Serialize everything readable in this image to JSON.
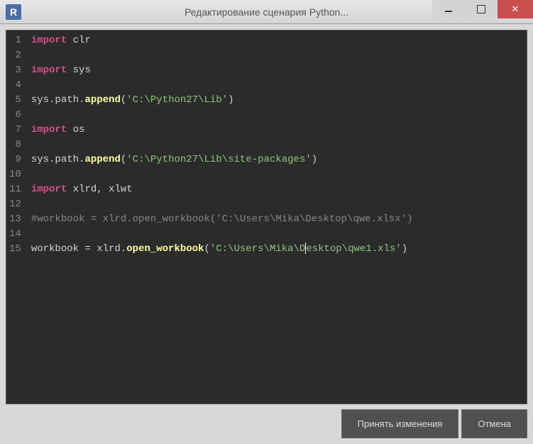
{
  "window": {
    "app_icon_letter": "R",
    "title": "Редактирование сценария Python..."
  },
  "editor": {
    "lines": [
      {
        "num": "1",
        "tokens": [
          {
            "cls": "kw-import",
            "t": "import"
          },
          {
            "cls": "plain",
            "t": " clr"
          }
        ]
      },
      {
        "num": "2",
        "tokens": []
      },
      {
        "num": "3",
        "tokens": [
          {
            "cls": "kw-import",
            "t": "import"
          },
          {
            "cls": "plain",
            "t": " sys"
          }
        ]
      },
      {
        "num": "4",
        "tokens": []
      },
      {
        "num": "5",
        "tokens": [
          {
            "cls": "plain",
            "t": "sys.path."
          },
          {
            "cls": "kw-method",
            "t": "append"
          },
          {
            "cls": "plain",
            "t": "("
          },
          {
            "cls": "string",
            "t": "'C:\\Python27\\Lib'"
          },
          {
            "cls": "plain",
            "t": ")"
          }
        ]
      },
      {
        "num": "6",
        "tokens": []
      },
      {
        "num": "7",
        "tokens": [
          {
            "cls": "kw-import",
            "t": "import"
          },
          {
            "cls": "plain",
            "t": " os"
          }
        ]
      },
      {
        "num": "8",
        "tokens": []
      },
      {
        "num": "9",
        "tokens": [
          {
            "cls": "plain",
            "t": "sys.path."
          },
          {
            "cls": "kw-method",
            "t": "append"
          },
          {
            "cls": "plain",
            "t": "("
          },
          {
            "cls": "string",
            "t": "'C:\\Python27\\Lib\\site-packages'"
          },
          {
            "cls": "plain",
            "t": ")"
          }
        ]
      },
      {
        "num": "10",
        "tokens": []
      },
      {
        "num": "11",
        "tokens": [
          {
            "cls": "kw-import",
            "t": "import"
          },
          {
            "cls": "plain",
            "t": " xlrd, xlwt"
          }
        ]
      },
      {
        "num": "12",
        "tokens": []
      },
      {
        "num": "13",
        "tokens": [
          {
            "cls": "comment",
            "t": "#workbook = xlrd.open_workbook('C:\\Users\\Mika\\Desktop\\qwe.xlsx')"
          }
        ]
      },
      {
        "num": "14",
        "tokens": []
      },
      {
        "num": "15",
        "tokens": [
          {
            "cls": "plain",
            "t": "workbook = xlrd."
          },
          {
            "cls": "kw-method",
            "t": "open_workbook"
          },
          {
            "cls": "plain",
            "t": "("
          },
          {
            "cls": "string",
            "t": "'C:\\Users\\Mika\\D"
          },
          {
            "cls": "cursor",
            "t": ""
          },
          {
            "cls": "string",
            "t": "esktop\\qwe1.xls'"
          },
          {
            "cls": "plain",
            "t": ")"
          }
        ]
      }
    ]
  },
  "buttons": {
    "accept": "Принять изменения",
    "cancel": "Отмена"
  }
}
